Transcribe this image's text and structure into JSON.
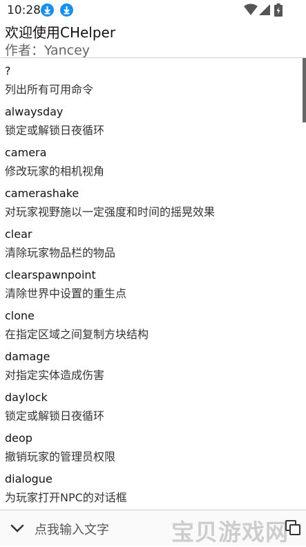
{
  "status_bar": {
    "time": "10:28",
    "notification_icons": [
      "download-icon",
      "download-icon"
    ],
    "system_icons": [
      "wifi-icon",
      "signal-icon",
      "battery-icon"
    ]
  },
  "header": {
    "title": "欢迎使用CHelper",
    "author": "作者：Yancey"
  },
  "commands": [
    {
      "name": "?",
      "description": "列出所有可用命令"
    },
    {
      "name": "alwaysday",
      "description": "锁定或解锁日夜循环"
    },
    {
      "name": "camera",
      "description": "修改玩家的相机视角"
    },
    {
      "name": "camerashake",
      "description": "对玩家视野施以一定强度和时间的摇晃效果"
    },
    {
      "name": "clear",
      "description": "清除玩家物品栏的物品"
    },
    {
      "name": "clearspawnpoint",
      "description": "清除世界中设置的重生点"
    },
    {
      "name": "clone",
      "description": "在指定区域之间复制方块结构"
    },
    {
      "name": "damage",
      "description": "对指定实体造成伤害"
    },
    {
      "name": "daylock",
      "description": "锁定或解锁日夜循环"
    },
    {
      "name": "deop",
      "description": "撤销玩家的管理员权限"
    },
    {
      "name": "dialogue",
      "description": "为玩家打开NPC的对话框"
    }
  ],
  "input_bar": {
    "placeholder": "点我输入文字",
    "watermark": "宝贝游戏网"
  },
  "colors": {
    "accent": "#1a8fe8",
    "text_primary": "#111111",
    "text_secondary": "#333333"
  }
}
